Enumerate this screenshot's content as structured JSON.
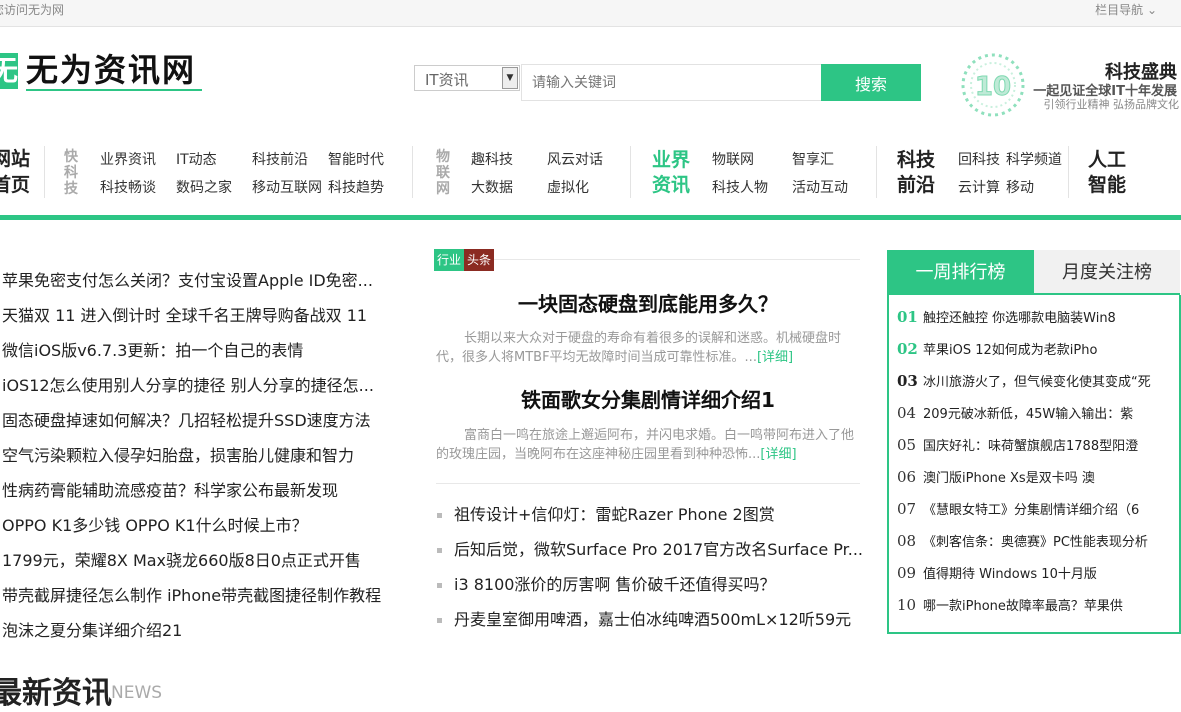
{
  "topbar": {
    "left": "您访问无为网",
    "right": "栏目导航"
  },
  "logo": {
    "box_char": "无",
    "text": "无为资讯网"
  },
  "search": {
    "category": "IT资讯",
    "placeholder": "请输入关键词",
    "button": "搜索"
  },
  "promo": {
    "badge_num": "10",
    "title": "科技盛典",
    "subtitle": "一起见证全球IT十年发展",
    "tagline": "引领行业精神 弘扬品牌文化"
  },
  "nav": {
    "home": [
      "网站",
      "首页"
    ],
    "group1": {
      "label": "快科技",
      "links": [
        "业界资讯",
        "IT动态",
        "科技前沿",
        "智能时代",
        "科技畅谈",
        "数码之家",
        "移动互联网",
        "科技趋势"
      ]
    },
    "group2": {
      "label": "物联网",
      "links": [
        "趣科技",
        "风云对话",
        "大数据",
        "虚拟化"
      ]
    },
    "group3": {
      "label": [
        "业界",
        "资讯"
      ],
      "links": [
        "物联网",
        "智享汇",
        "科技人物",
        "活动互动"
      ]
    },
    "group4": {
      "label": [
        "科技",
        "前沿"
      ],
      "links": [
        "回科技",
        "科学频道",
        "云计算",
        "移动"
      ]
    },
    "group5": {
      "label": [
        "人工",
        "智能"
      ]
    }
  },
  "left_list": [
    "苹果免密支付怎么关闭？支付宝设置Apple ID免密...",
    "天猫双 11 进入倒计时 全球千名王牌导购备战双 11",
    "微信iOS版v6.7.3更新：拍一个自己的表情",
    "iOS12怎么使用别人分享的捷径 别人分享的捷径怎...",
    "固态硬盘掉速如何解决？几招轻松提升SSD速度方法",
    "空气污染颗粒入侵孕妇胎盘，损害胎儿健康和智力",
    "性病药膏能辅助流感疫苗？科学家公布最新发现",
    "OPPO K1多少钱 OPPO K1什么时候上市？",
    "1799元，荣耀8X Max骁龙660版8日0点正式开售",
    "带壳截屏捷径怎么制作 iPhone带壳截图捷径制作教程",
    "泡沫之夏分集详细介绍21"
  ],
  "latest": {
    "title": "最新资讯",
    "en": "NEWS"
  },
  "headline": {
    "tag_a": "行业",
    "tag_b": "头条",
    "articles": [
      {
        "title": "一块固态硬盘到底能用多久？",
        "desc": "长期以来大众对于硬盘的寿命有着很多的误解和迷惑。机械硬盘时代，很多人将MTBF平均无故障时间当成可靠性标准。...",
        "more": "[详细]"
      },
      {
        "title": "铁面歌女分集剧情详细介绍1",
        "desc": "富商白一鸣在旅途上邂逅阿布，并闪电求婚。白一鸣带阿布进入了他的玫瑰庄园，当晚阿布在这座神秘庄园里看到种种恐怖...",
        "more": "[详细]"
      }
    ],
    "list": [
      "祖传设计+信仰灯：雷蛇Razer Phone 2图赏",
      "后知后觉，微软Surface Pro 2017官方改名Surface Pr...",
      "i3 8100涨价的厉害啊 售价破千还值得买吗？",
      "丹麦皇室御用啤酒，嘉士伯冰纯啤酒500mL×12听59元"
    ]
  },
  "ranking": {
    "tab_a": "一周排行榜",
    "tab_b": "月度关注榜",
    "items": [
      {
        "num": "01",
        "text": "触控还触控 你选哪款电脑装Win8"
      },
      {
        "num": "02",
        "text": "苹果iOS 12如何成为老款iPho"
      },
      {
        "num": "03",
        "text": "冰川旅游火了，但气候变化使其变成“死"
      },
      {
        "num": "04",
        "text": "209元破冰新低，45W输入输出：紫"
      },
      {
        "num": "05",
        "text": "国庆好礼：味荷蟹旗舰店1788型阳澄"
      },
      {
        "num": "06",
        "text": "澳门版iPhone Xs是双卡吗 澳"
      },
      {
        "num": "07",
        "text": "《慧眼女特工》分集剧情详细介绍（6"
      },
      {
        "num": "08",
        "text": "《刺客信条：奥德赛》PC性能表现分析"
      },
      {
        "num": "09",
        "text": "值得期待 Windows 10十月版"
      },
      {
        "num": "10",
        "text": "哪一款iPhone故障率最高？苹果供"
      }
    ]
  },
  "colors": {
    "accent": "#2dc585",
    "tag_dark": "#8b2b22"
  }
}
